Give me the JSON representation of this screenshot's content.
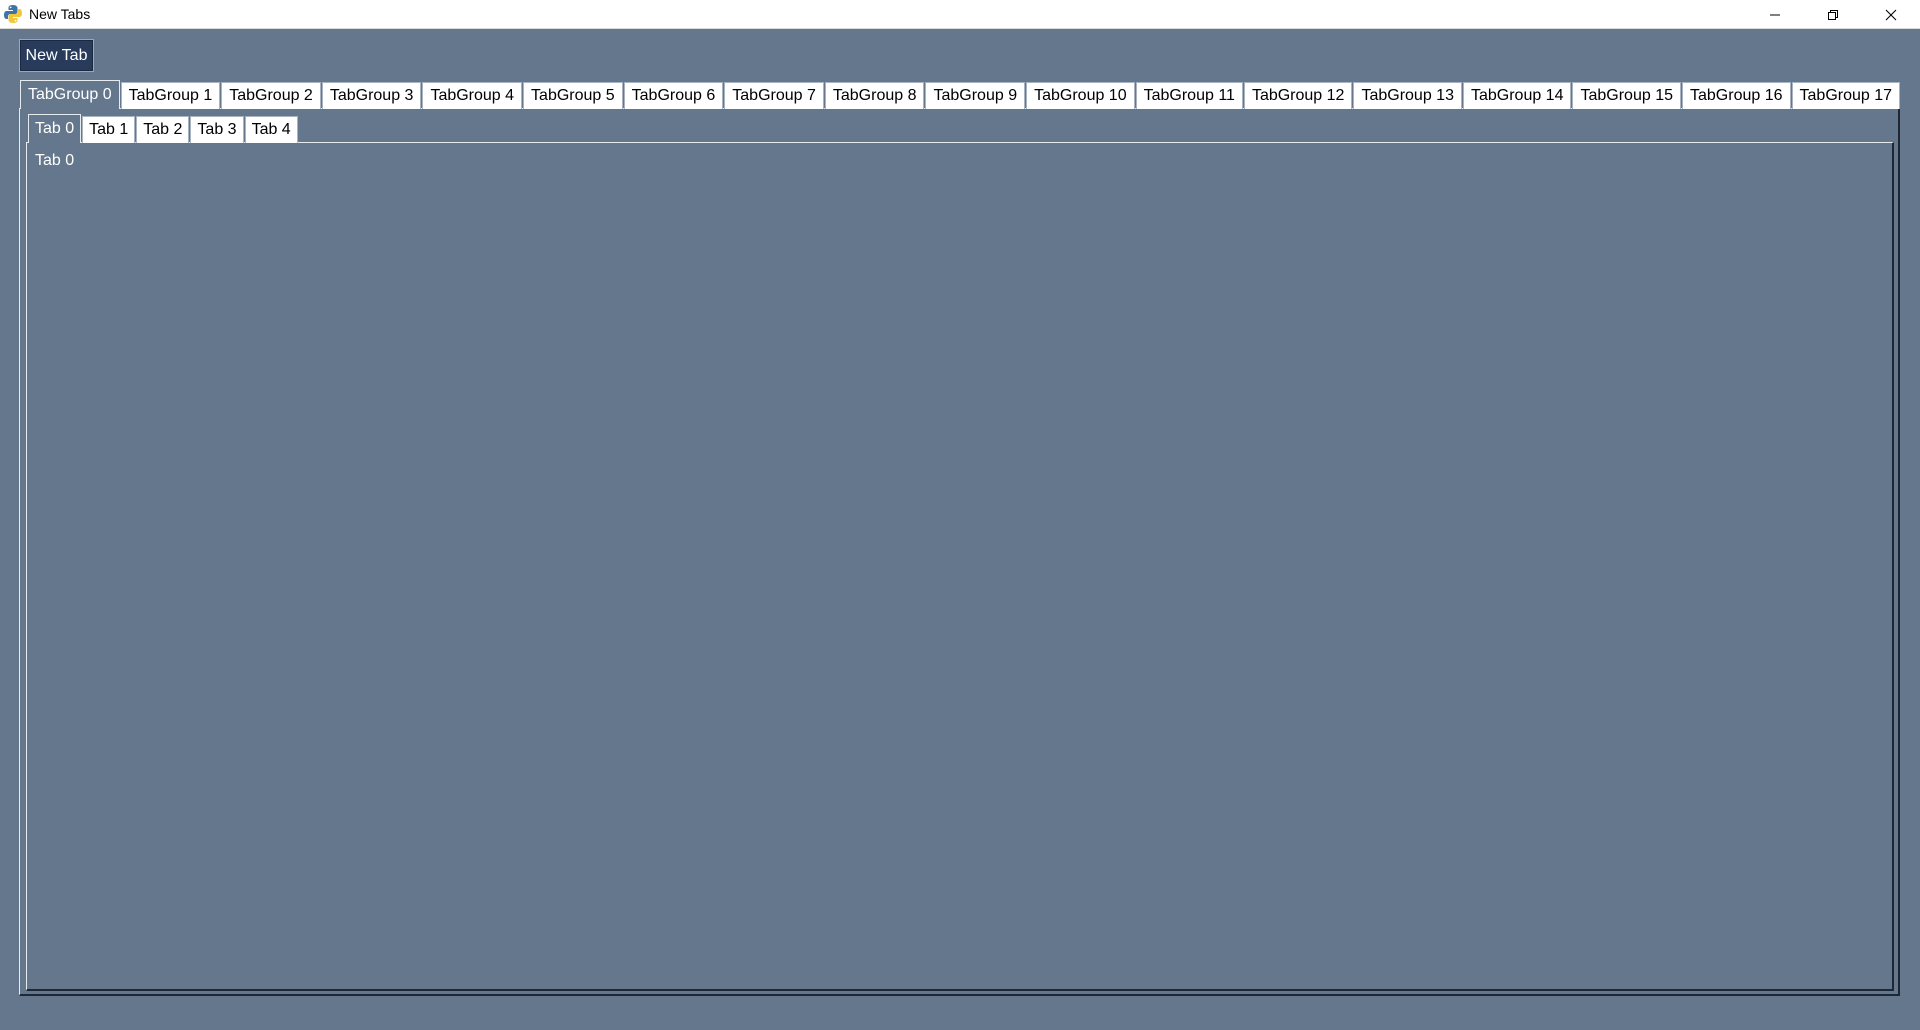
{
  "window": {
    "title": "New Tabs",
    "icon": "python-icon",
    "controls": [
      "minimize-icon",
      "restore-icon",
      "close-icon"
    ]
  },
  "toolbar": {
    "new_tab_label": "New Tab"
  },
  "tab_groups": [
    {
      "label": "TabGroup 0",
      "active": true
    },
    {
      "label": "TabGroup 1"
    },
    {
      "label": "TabGroup 2"
    },
    {
      "label": "TabGroup 3"
    },
    {
      "label": "TabGroup 4"
    },
    {
      "label": "TabGroup 5"
    },
    {
      "label": "TabGroup 6"
    },
    {
      "label": "TabGroup 7"
    },
    {
      "label": "TabGroup 8"
    },
    {
      "label": "TabGroup 9"
    },
    {
      "label": "TabGroup 10"
    },
    {
      "label": "TabGroup 11"
    },
    {
      "label": "TabGroup 12"
    },
    {
      "label": "TabGroup 13"
    },
    {
      "label": "TabGroup 14"
    },
    {
      "label": "TabGroup 15"
    },
    {
      "label": "TabGroup 16"
    },
    {
      "label": "TabGroup 17"
    }
  ],
  "inner_tabs": [
    {
      "label": "Tab 0",
      "active": true
    },
    {
      "label": "Tab 1"
    },
    {
      "label": "Tab 2"
    },
    {
      "label": "Tab 3"
    },
    {
      "label": "Tab 4"
    }
  ],
  "panel": {
    "text": "Tab 0"
  },
  "colors": {
    "background": "#64778d",
    "button": "#283b5b"
  }
}
